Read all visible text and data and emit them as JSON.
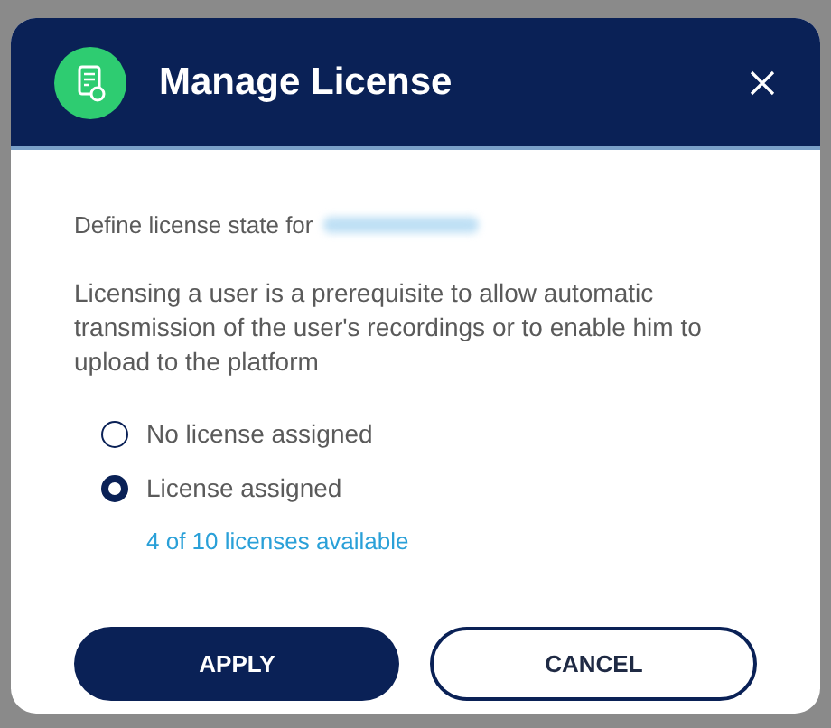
{
  "dialog": {
    "title": "Manage License",
    "intro": "Define license state for",
    "description": "Licensing a user is a prerequisite to allow automatic transmission of the user's recordings or to enable him to upload to the platform",
    "options": [
      {
        "label": "No license assigned",
        "selected": false
      },
      {
        "label": "License assigned",
        "selected": true
      }
    ],
    "availability_link": "4 of 10 licenses available",
    "buttons": [
      {
        "label": "APPLY",
        "kind": "primary"
      },
      {
        "label": "CANCEL",
        "kind": "secondary"
      }
    ]
  }
}
